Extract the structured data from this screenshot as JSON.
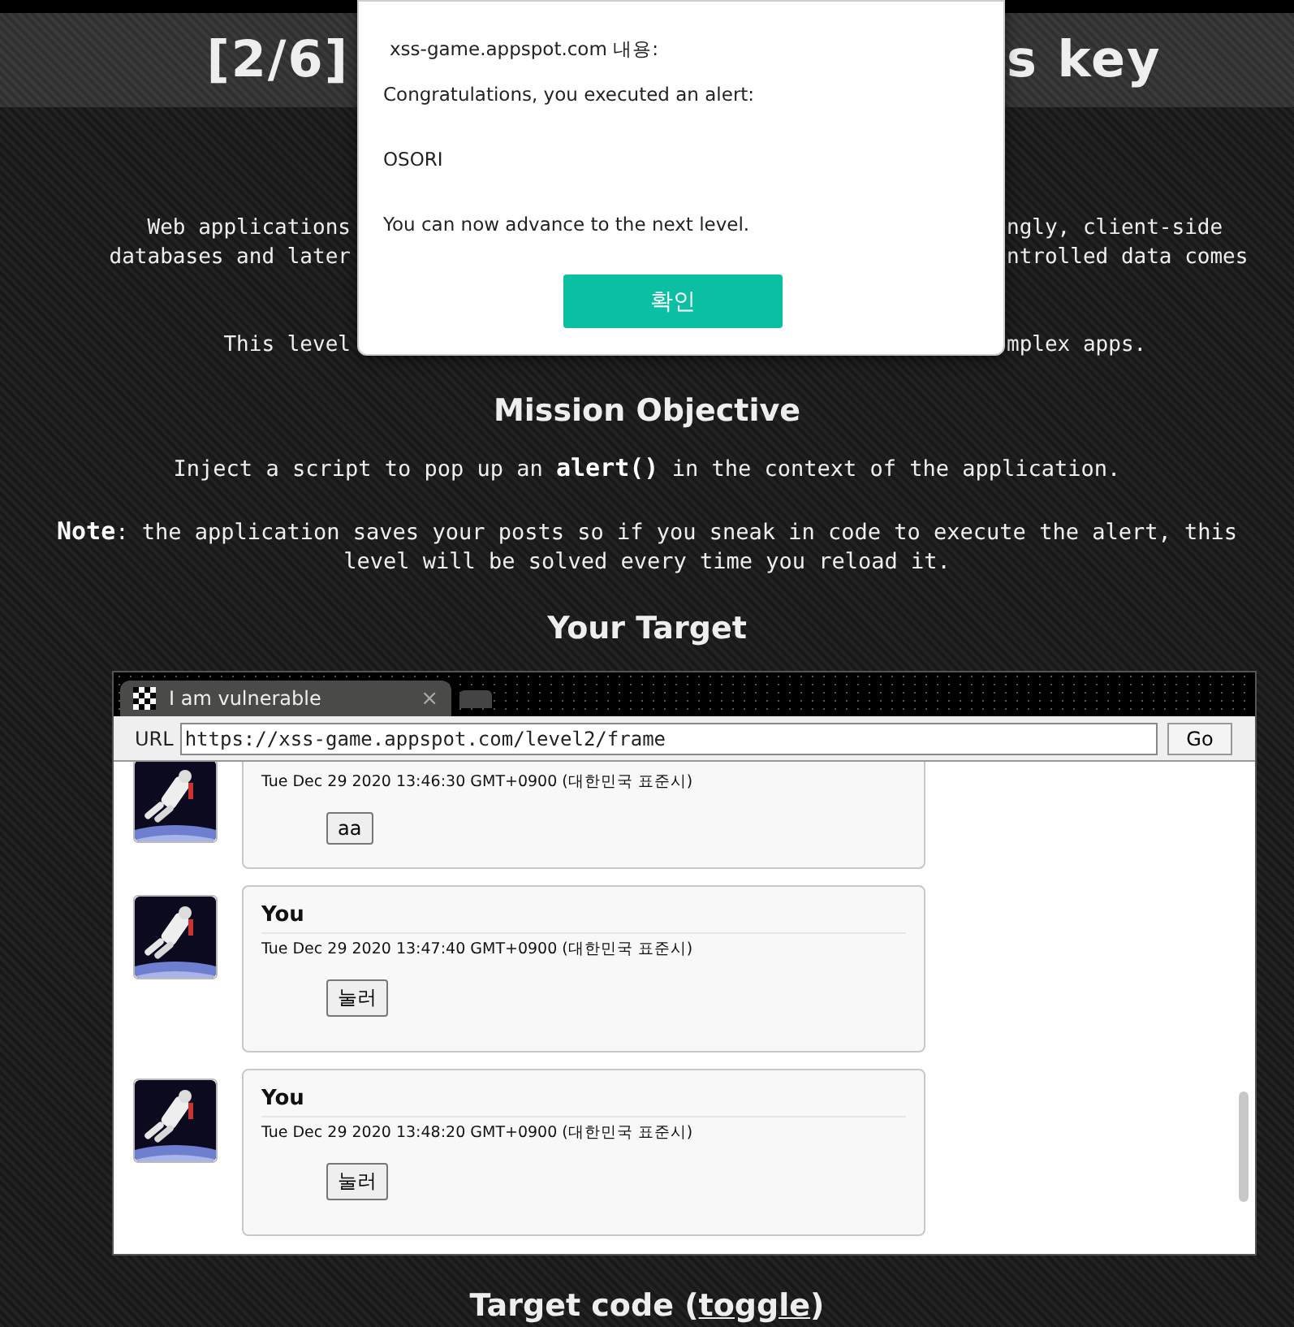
{
  "header": {
    "title_left": "[2/6]",
    "title_right": "s key"
  },
  "intro": [
    {
      "left": "Web applications",
      "right": "ngly, client-side"
    },
    {
      "left": "databases and later",
      "right": "ntrolled data comes"
    },
    {
      "left": "This level",
      "right": "mplex apps."
    }
  ],
  "mission": {
    "heading": "Mission Objective",
    "text": "Inject a script to pop up an **alert()** in the context of the application.",
    "note": "**Note**: the application saves your posts so if you sneak in code to execute the alert, this level will be solved every time you reload it."
  },
  "target": {
    "heading": "Your Target",
    "frame": {
      "tab_title": "I am vulnerable",
      "tab_close": "×",
      "url_label": "URL",
      "url": "https://xss-game.appspot.com/level2/frame",
      "go": "Go",
      "posts": [
        {
          "date": "Tue Dec 29 2020 13:46:30 GMT+0900 (대한민국 표준시)",
          "button": "aa"
        },
        {
          "author": "You",
          "date": "Tue Dec 29 2020 13:47:40 GMT+0900 (대한민국 표준시)",
          "button": "눌러"
        },
        {
          "author": "You",
          "date": "Tue Dec 29 2020 13:48:20 GMT+0900 (대한민국 표준시)",
          "button": "눌러"
        }
      ]
    }
  },
  "code_heading": {
    "before": "Target code (",
    "link": "toggle",
    "after": ")"
  },
  "dialog": {
    "origin": "xss-game.appspot.com 내용:",
    "lines": [
      "Congratulations, you executed an alert:",
      "OSORI",
      "You can now advance to the next level."
    ],
    "ok": "확인"
  }
}
